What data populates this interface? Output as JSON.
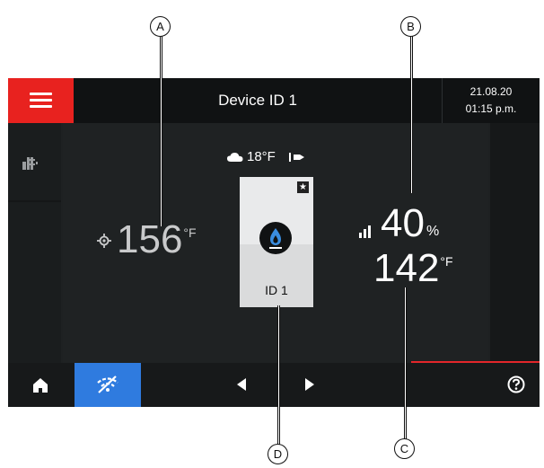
{
  "header": {
    "title": "Device ID 1",
    "date": "21.08.20",
    "time": "01:15 p.m."
  },
  "icons": {
    "menu": "hamburger-menu-icon",
    "system": "radiator-icon",
    "outdoor": "cloud-icon",
    "burner": "flame-icon",
    "favourite": "star-icon",
    "modulation": "signal-bars-icon",
    "home": "home-icon",
    "connectivity": "wifi-off-icon",
    "previous": "arrow-left-icon",
    "next": "arrow-right-icon",
    "help": "help-icon"
  },
  "main": {
    "outdoor_temp": "18°F",
    "flow_temp_value": "156",
    "flow_temp_unit": "°F",
    "boiler_label": "ID 1",
    "modulation_value": "40",
    "modulation_unit": "%",
    "dhw_temp_value": "142",
    "dhw_temp_unit": "°F"
  },
  "callouts": {
    "a": "A",
    "b": "B",
    "c": "C",
    "d": "D"
  },
  "colors": {
    "accent_red": "#e8221f",
    "accent_blue": "#2f7bdf",
    "screen_bg": "#1e2122",
    "flame_blue": "#3a8de0"
  }
}
